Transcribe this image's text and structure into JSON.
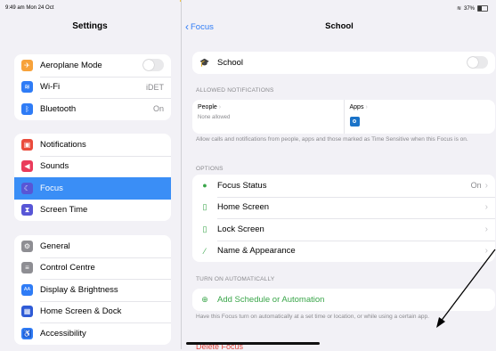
{
  "status": {
    "time": "9:49 am  Mon 24 Oct",
    "battery": "37%"
  },
  "sidebar": {
    "title": "Settings",
    "groups": [
      [
        {
          "label": "Aeroplane Mode",
          "icon": "airplane-icon",
          "color": "#f7a23b",
          "glyph": "✈",
          "toggle": true
        },
        {
          "label": "Wi-Fi",
          "icon": "wifi-icon",
          "color": "#2f7cf6",
          "glyph": "≋",
          "value": "iDET"
        },
        {
          "label": "Bluetooth",
          "icon": "bluetooth-icon",
          "color": "#2f7cf6",
          "glyph": "ᛒ",
          "value": "On"
        }
      ],
      [
        {
          "label": "Notifications",
          "icon": "notifications-icon",
          "color": "#ea4b3c",
          "glyph": "▣"
        },
        {
          "label": "Sounds",
          "icon": "sounds-icon",
          "color": "#ea3b5b",
          "glyph": "◀"
        },
        {
          "label": "Focus",
          "icon": "focus-moon-icon",
          "color": "#5856d6",
          "glyph": "☾",
          "selected": true
        },
        {
          "label": "Screen Time",
          "icon": "screen-time-icon",
          "color": "#5856d6",
          "glyph": "⧗"
        }
      ],
      [
        {
          "label": "General",
          "icon": "general-gear-icon",
          "color": "#8e8e93",
          "glyph": "⚙"
        },
        {
          "label": "Control Centre",
          "icon": "control-centre-icon",
          "color": "#8e8e93",
          "glyph": "≡"
        },
        {
          "label": "Display & Brightness",
          "icon": "display-icon",
          "color": "#2f7cf6",
          "glyph": "AA"
        },
        {
          "label": "Home Screen & Dock",
          "icon": "home-screen-icon",
          "color": "#2f5bd6",
          "glyph": "▦"
        },
        {
          "label": "Accessibility",
          "icon": "accessibility-icon",
          "color": "#2f7cf6",
          "glyph": "♿"
        }
      ]
    ]
  },
  "main": {
    "back_label": "Focus",
    "title": "School",
    "focus_name": "School",
    "allowed_header": "ALLOWED NOTIFICATIONS",
    "people_label": "People",
    "people_sub": "None allowed",
    "apps_label": "Apps",
    "allowed_footnote": "Allow calls and notifications from people, apps and those marked as Time Sensitive when this Focus is on.",
    "options_header": "OPTIONS",
    "options": [
      {
        "label": "Focus Status",
        "icon": "focus-status-icon",
        "glyph": "●",
        "value": "On"
      },
      {
        "label": "Home Screen",
        "icon": "home-screen-phone-icon",
        "glyph": "▯",
        "value": ""
      },
      {
        "label": "Lock Screen",
        "icon": "lock-screen-phone-icon",
        "glyph": "▯",
        "value": ""
      },
      {
        "label": "Name & Appearance",
        "icon": "pencil-icon",
        "glyph": "⁄",
        "value": ""
      }
    ],
    "auto_header": "TURN ON AUTOMATICALLY",
    "add_schedule": "Add Schedule or Automation",
    "auto_footnote": "Have this Focus turn on automatically at a set time or location, or while using a certain app.",
    "delete_label": "Delete Focus"
  },
  "colors": {
    "accent": "#2f7cf6",
    "selected": "#3a8ef6",
    "green": "#3aa64a"
  }
}
